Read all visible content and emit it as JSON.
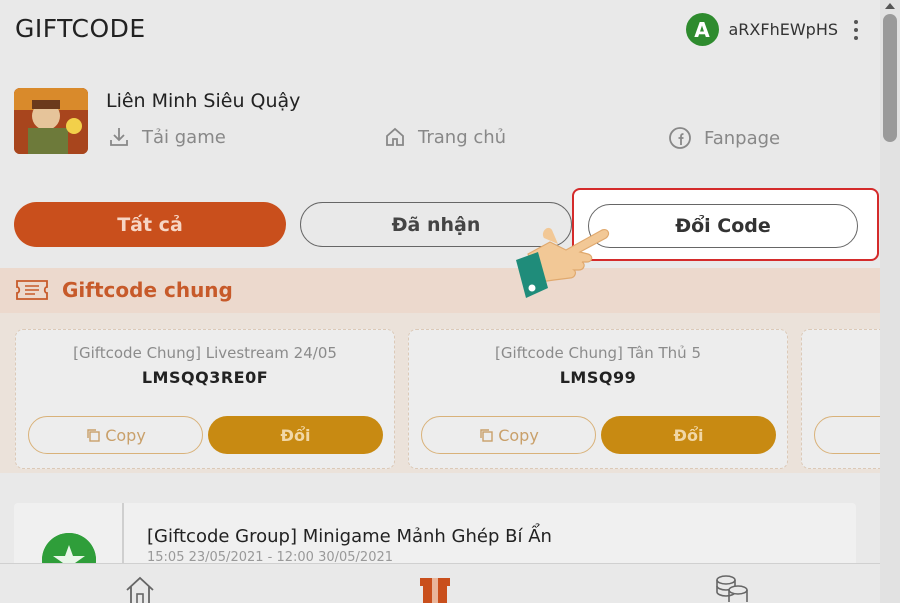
{
  "header": {
    "title": "GIFTCODE",
    "avatar_letter": "A",
    "username": "aRXFhEWpHS",
    "menu_icon": "kebab-icon"
  },
  "game": {
    "name": "Liên Minh Siêu Quậy",
    "links": [
      {
        "label": "Tải game",
        "icon": "download-icon"
      },
      {
        "label": "Trang chủ",
        "icon": "home-icon"
      },
      {
        "label": "Fanpage",
        "icon": "facebook-icon"
      }
    ]
  },
  "tabs": {
    "all": "Tất cả",
    "received": "Đã nhận",
    "redeem": "Đổi Code"
  },
  "section": {
    "title": "Giftcode chung",
    "icon": "ticket-icon"
  },
  "codes": [
    {
      "title": "[Giftcode Chung] Livestream 24/05",
      "code": "LMSQQ3RE0F",
      "copy_label": "Copy",
      "redeem_label": "Đổi"
    },
    {
      "title": "[Giftcode Chung] Tân Thủ 5",
      "code": "LMSQ99",
      "copy_label": "Copy",
      "redeem_label": "Đổi"
    }
  ],
  "group": {
    "title": "[Giftcode Group] Minigame Mảnh Ghép Bí Ẩn",
    "time": "15:05 23/05/2021 - 12:00 30/05/2021",
    "icon": "star-icon"
  },
  "bottom_nav": [
    "home-icon",
    "gift-box-icon",
    "coins-icon"
  ],
  "colors": {
    "primary": "#c94f1c",
    "redeem_button": "#c88a12",
    "highlight_border": "#d42b2b",
    "avatar": "#2e8b2e"
  }
}
